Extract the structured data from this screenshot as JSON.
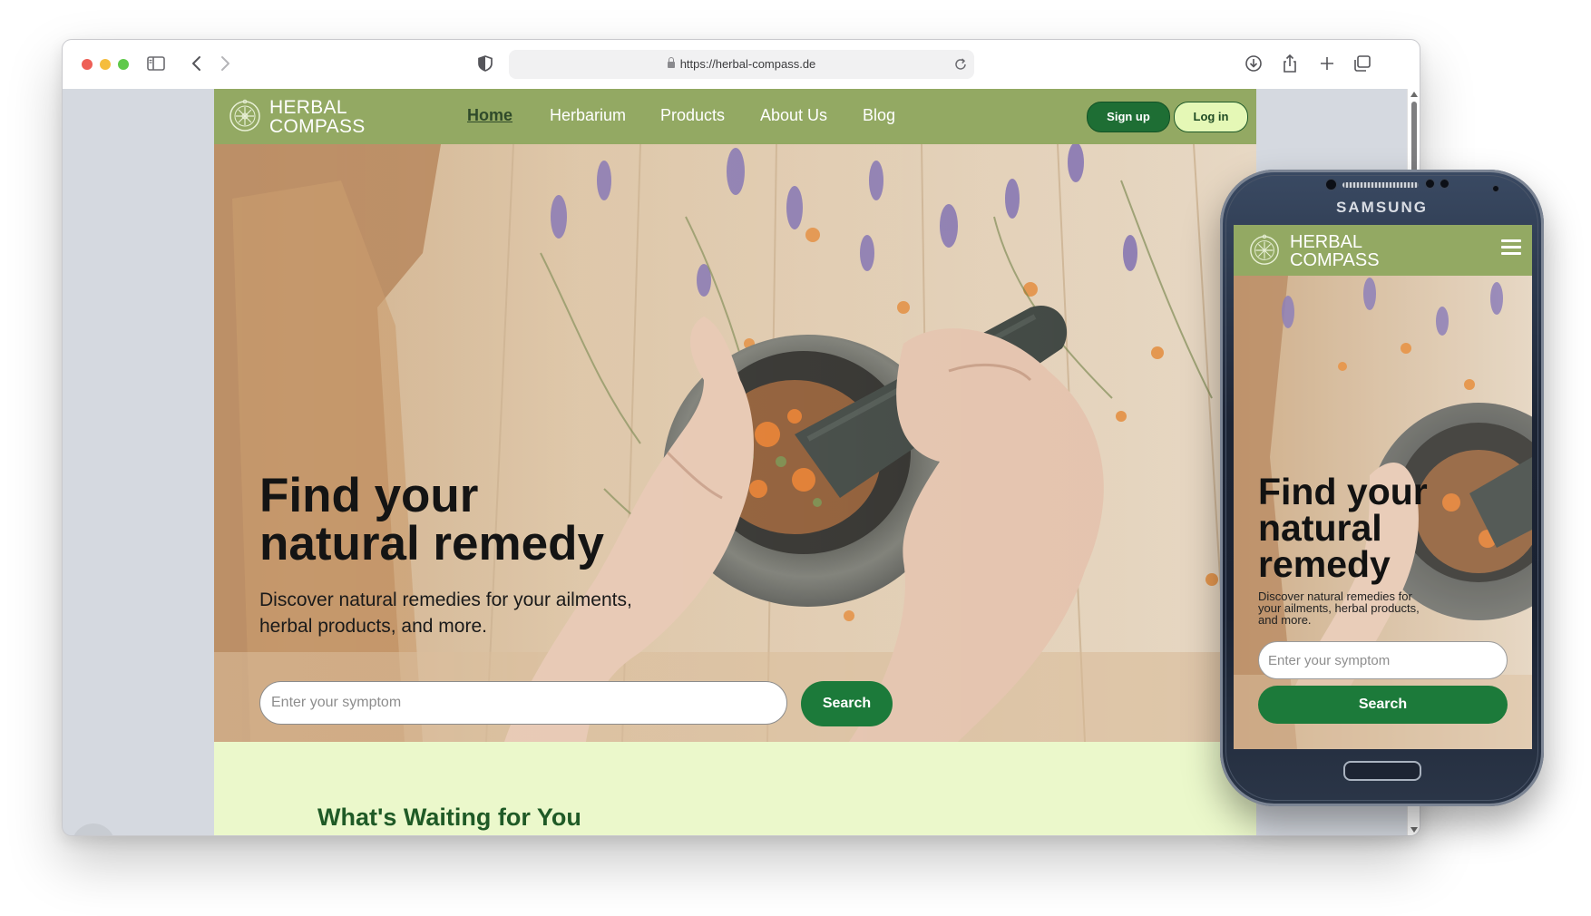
{
  "browser": {
    "url": "https://herbal-compass.de"
  },
  "site": {
    "logo_line1": "HERBAL",
    "logo_line2": "COMPASS",
    "nav": [
      {
        "label": "Home",
        "active": true
      },
      {
        "label": "Herbarium",
        "active": false
      },
      {
        "label": "Products",
        "active": false
      },
      {
        "label": "About Us",
        "active": false
      },
      {
        "label": "Blog",
        "active": false
      }
    ],
    "signup_label": "Sign up",
    "login_label": "Log in",
    "hero": {
      "title_line1": "Find your",
      "title_line2": "natural remedy",
      "subtitle": "Discover natural remedies for your ailments, herbal products, and more.",
      "search_placeholder": "Enter your symptom",
      "search_button": "Search"
    },
    "section_title": "What's Waiting for You"
  },
  "phone": {
    "brand": "SAMSUNG",
    "logo_line1": "HERBAL",
    "logo_line2": "COMPASS",
    "hero": {
      "title_line1": "Find your",
      "title_line2": "natural",
      "title_line3": "remedy",
      "subtitle": "Discover natural remedies for your ailments, herbal products, and more.",
      "search_placeholder": "Enter your symptom",
      "search_button": "Search"
    }
  },
  "colors": {
    "nav_green": "#93a963",
    "button_green": "#1c7a3a",
    "login_bg": "#e5f8b6",
    "section_bg": "#ebf8cb",
    "section_title": "#1f5a26"
  }
}
